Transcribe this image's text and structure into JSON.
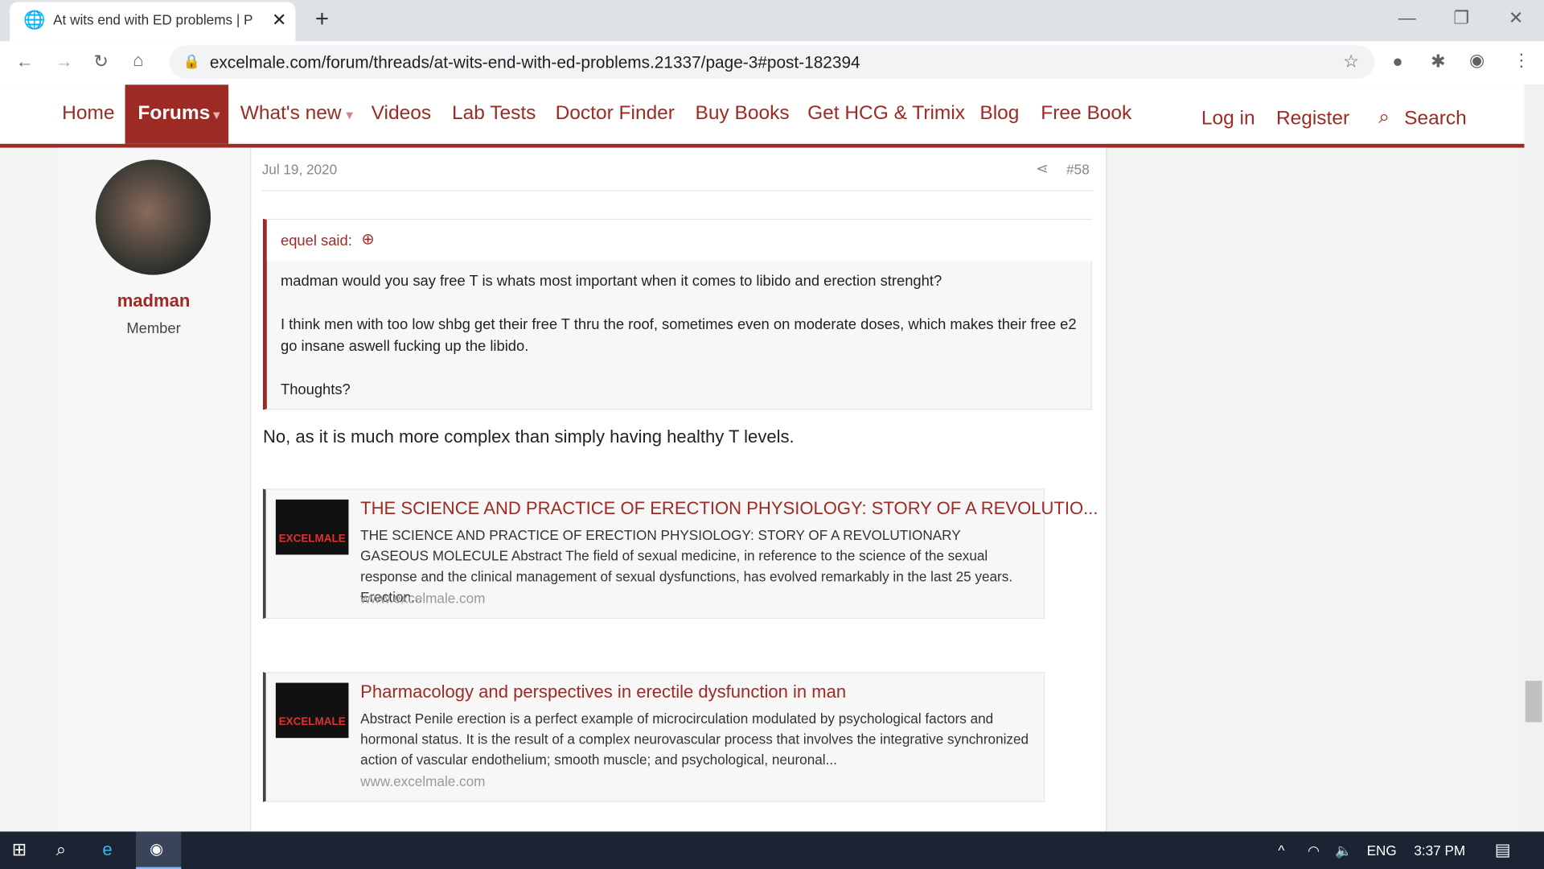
{
  "browser": {
    "tab_title": "At wits end with ED problems | P",
    "url": "excelmale.com/forum/threads/at-wits-end-with-ed-problems.21337/page-3#post-182394"
  },
  "nav": {
    "items": [
      "Home",
      "Forums",
      "What's new",
      "Videos",
      "Lab Tests",
      "Doctor Finder",
      "Buy Books",
      "Get HCG & Trimix",
      "Blog",
      "Free Book"
    ],
    "login": "Log in",
    "register": "Register",
    "search": "Search"
  },
  "post": {
    "author": "madman",
    "role": "Member",
    "date": "Jul 19, 2020",
    "number": "#58",
    "quote": {
      "author": "equel said:",
      "lines": [
        "madman would you say free T is whats most important when it comes to libido and erection strenght?",
        "I think men with too low shbg get their free T thru the roof, sometimes even on moderate doses, which makes their free e2 go insane aswell fucking up the libido.",
        "Thoughts?"
      ]
    },
    "body": "No, as it is much more complex than simply having healthy T levels.",
    "links": [
      {
        "title": "THE SCIENCE AND PRACTICE OF ERECTION PHYSIOLOGY: STORY OF A REVOLUTIO...",
        "desc": "THE SCIENCE AND PRACTICE OF ERECTION PHYSIOLOGY: STORY OF A REVOLUTIONARY GASEOUS MOLECULE Abstract The field of sexual medicine, in reference to the science of the sexual response and the clinical management of sexual dysfunctions, has evolved remarkably in the last 25 years. Erection...",
        "domain": "www.excelmale.com",
        "logo": "EXCELMALE"
      },
      {
        "title": "Pharmacology and perspectives in erectile dysfunction in man",
        "desc": "Abstract Penile erection is a perfect example of microcirculation modulated by psychological factors and hormonal status. It is the result of a complex neurovascular process that involves the integrative synchronized action of vascular endothelium; smooth muscle; and psychological, neuronal...",
        "domain": "www.excelmale.com",
        "logo": "EXCELMALE"
      }
    ]
  },
  "taskbar": {
    "lang": "ENG",
    "time": "3:37 PM"
  },
  "colors": {
    "brand": "#9c2a25"
  }
}
